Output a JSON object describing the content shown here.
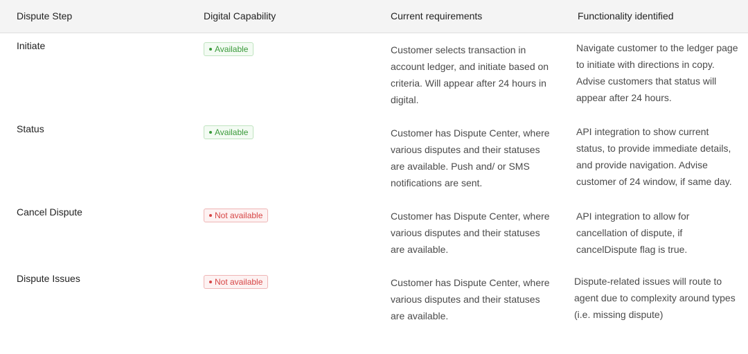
{
  "headers": {
    "step": "Dispute Step",
    "capability": "Digital Capability",
    "requirements": "Current requirements",
    "functionality": "Functionality identified"
  },
  "colors": {
    "available": "#3a9a3a",
    "not_available": "#d64545",
    "header_bg": "#f4f4f4"
  },
  "rows": [
    {
      "step": "Initiate",
      "status": "Available",
      "requirements": "Customer selects transaction in account ledger, and initiate based on criteria. Will appear after 24 hours in digital.",
      "functionality": "Navigate customer to the ledger page to initiate with directions in copy. Advise customers that status will appear after 24 hours."
    },
    {
      "step": "Status",
      "status": "Available",
      "requirements": "Customer has Dispute Center, where various disputes and their statuses are available. Push and/ or SMS notifications are sent.",
      "functionality": "API integration to show current status, to provide immediate details, and provide navigation. Advise customer of 24 window, if same day."
    },
    {
      "step": "Cancel Dispute",
      "status": "Not available",
      "requirements": "Customer has Dispute Center, where various disputes and their statuses are available.",
      "functionality": "API integration to allow for cancellation of dispute, if cancelDispute flag is true."
    },
    {
      "step": "Dispute Issues",
      "status": "Not available",
      "requirements": "Customer has Dispute Center, where various disputes and their statuses are available.",
      "functionality": "Dispute-related issues will route to agent due to complexity around types (i.e. missing dispute)"
    }
  ]
}
